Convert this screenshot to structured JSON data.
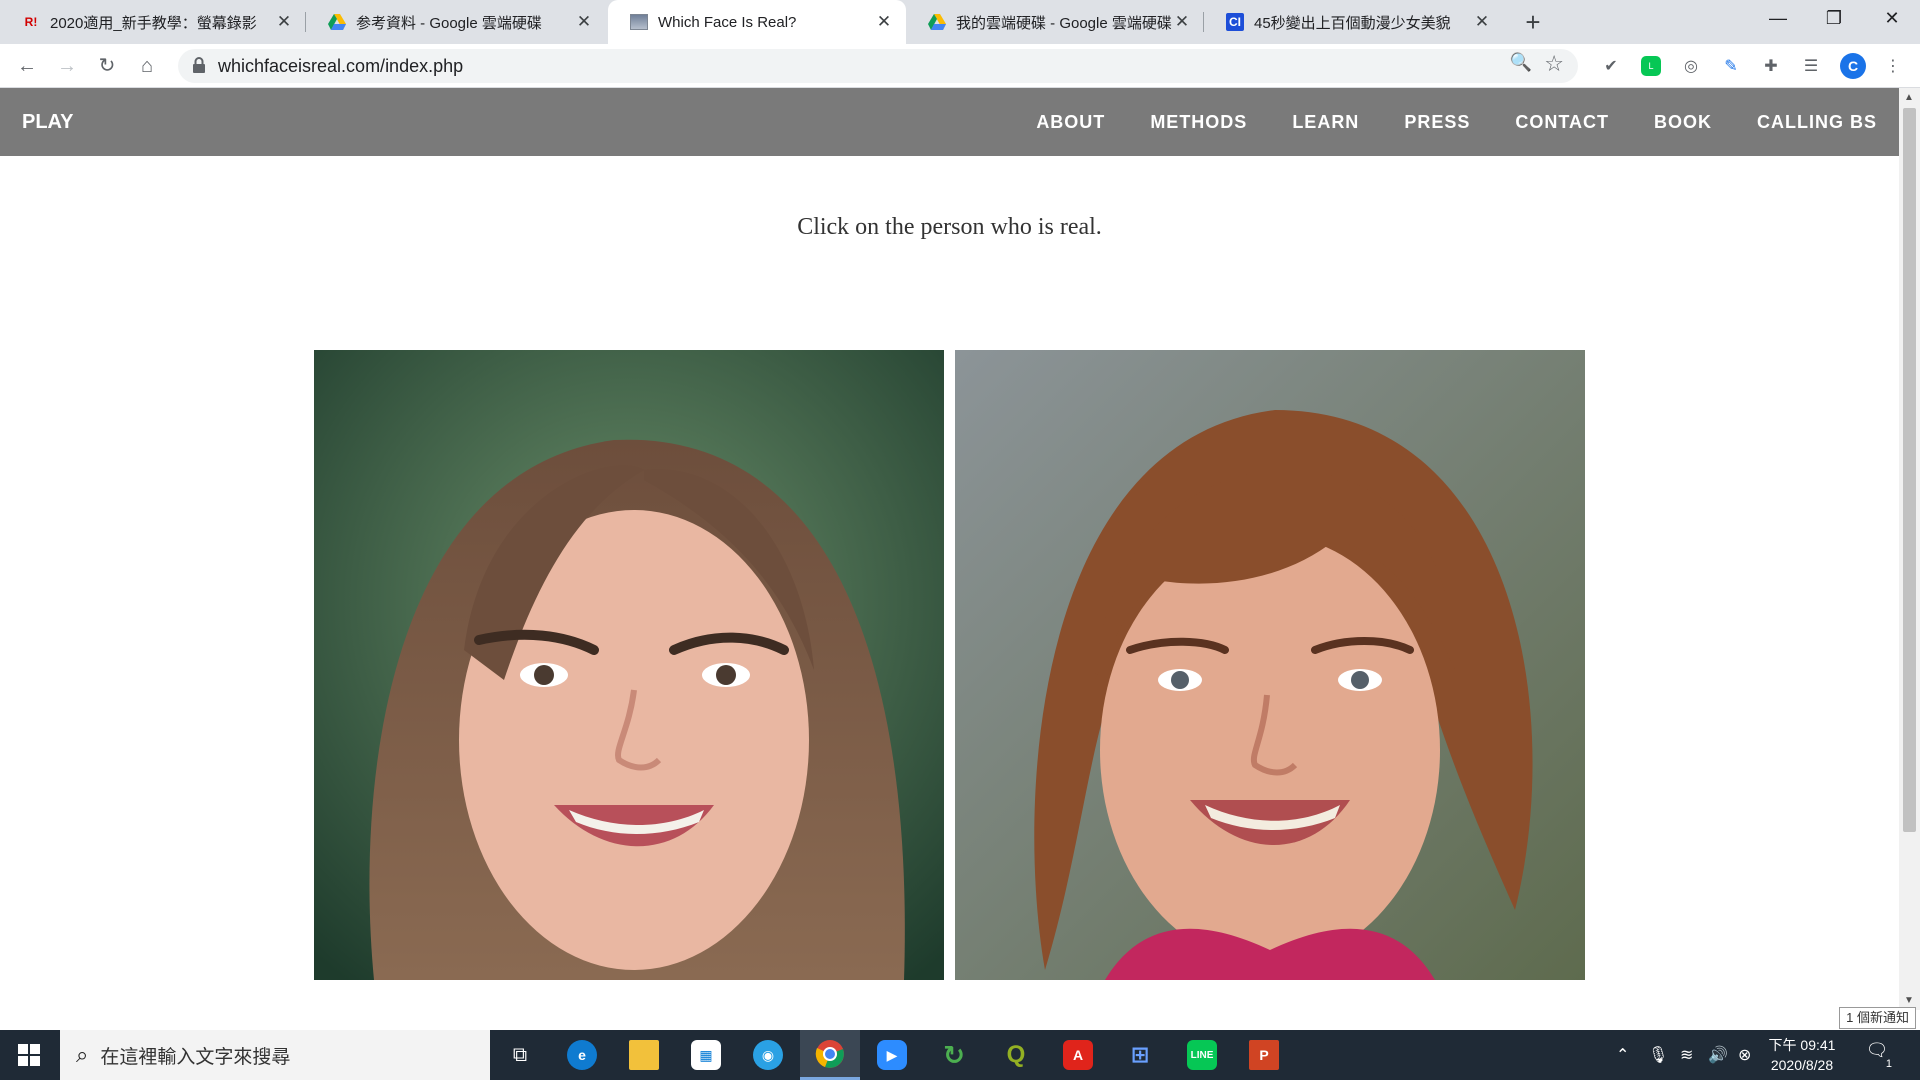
{
  "browser": {
    "tabs": [
      {
        "title": "2020適用_新手教學：螢幕錄影",
        "favicon": "r-icon",
        "active": false
      },
      {
        "title": "参考資料 - Google 雲端硬碟",
        "favicon": "google-drive-icon",
        "active": false
      },
      {
        "title": "Which Face Is Real?",
        "favicon": "image-icon",
        "active": true
      },
      {
        "title": "我的雲端硬碟 - Google 雲端硬碟",
        "favicon": "google-drive-icon",
        "active": false
      },
      {
        "title": "45秒變出上百個動漫少女美貌",
        "favicon": "ci-icon",
        "active": false
      }
    ],
    "favicon_labels": {
      "r": "R!",
      "ci": "CI"
    },
    "url": "whichfaceisreal.com/index.php",
    "profile_initial": "C"
  },
  "site": {
    "brand": "PLAY",
    "nav": [
      "ABOUT",
      "METHODS",
      "LEARN",
      "PRESS",
      "CONTACT",
      "BOOK",
      "CALLING BS"
    ],
    "instruction": "Click on the person who is real.",
    "faces": [
      {
        "description_icon": "face-long-brown-hair"
      },
      {
        "description_icon": "face-short-auburn-hair"
      }
    ]
  },
  "notification_tip": "1 個新通知",
  "taskbar": {
    "search_placeholder": "在這裡輸入文字來搜尋",
    "time": "下午 09:41",
    "date": "2020/8/28",
    "notification_count": "1"
  },
  "colors": {
    "nav_bg": "#7a7a7a",
    "tabstrip_bg": "#dee1e6",
    "taskbar_bg": "#1f2a36"
  }
}
